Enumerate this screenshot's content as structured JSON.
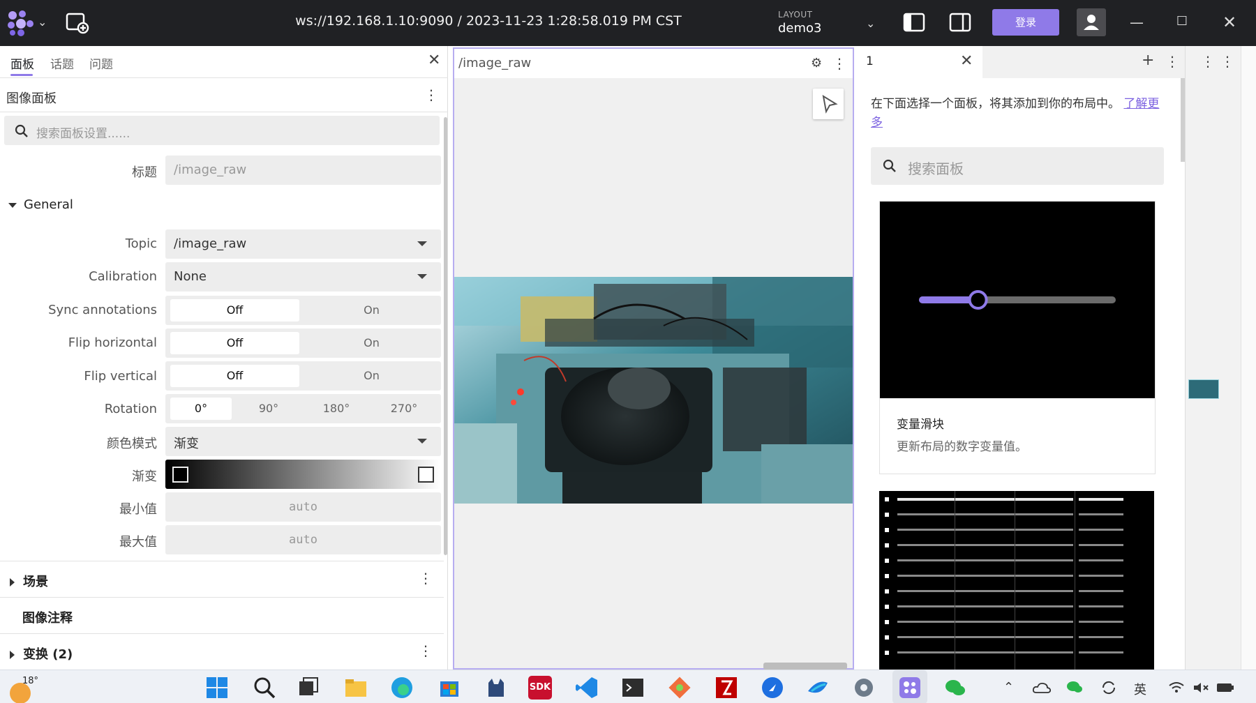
{
  "topbar": {
    "connection": "ws://192.168.1.10:9090 / 2023-11-23 1:28:58.019 PM CST",
    "layout_label": "LAYOUT",
    "layout_name": "demo3",
    "login_label": "登录",
    "win_min": "—",
    "win_max": "☐",
    "win_close": "✕"
  },
  "left_panel": {
    "tabs": [
      {
        "label": "面板",
        "active": true
      },
      {
        "label": "话题",
        "active": false
      },
      {
        "label": "问题",
        "active": false
      }
    ],
    "close": "✕",
    "panel_title": "图像面板",
    "search_placeholder": "搜索面板设置......",
    "title_label": "标题",
    "title_value": "/image_raw",
    "section_general": "General",
    "topic_label": "Topic",
    "topic_value": "/image_raw",
    "calibration_label": "Calibration",
    "calibration_value": "None",
    "sync_label": "Sync annotations",
    "flip_h_label": "Flip horizontal",
    "flip_v_label": "Flip vertical",
    "off_label": "Off",
    "on_label": "On",
    "rotation_label": "Rotation",
    "rotation_options": [
      "0°",
      "90°",
      "180°",
      "270°"
    ],
    "color_mode_label": "颜色模式",
    "color_mode_value": "渐变",
    "gradient_label": "渐变",
    "min_label": "最小值",
    "min_value": "auto",
    "max_label": "最大值",
    "max_value": "auto",
    "section_scene": "场景",
    "section_annotations": "图像注释",
    "section_transforms": "变换 (2)"
  },
  "mid_panel": {
    "title": "/image_raw"
  },
  "right_panel": {
    "tab_label": "1",
    "intro_text": "在下面选择一个面板，将其添加到你的布局中。",
    "intro_link": "了解更多",
    "search_placeholder": "搜索面板",
    "cards": [
      {
        "title": "变量滑块",
        "desc": "更新布局的数字变量值。",
        "slider_value": 0.3
      }
    ]
  },
  "taskbar": {
    "temperature": "18°",
    "sdk_label": "SDK",
    "ime_label": "英"
  },
  "colors": {
    "accent": "#8f7ae8",
    "topbar_bg": "#202124"
  }
}
